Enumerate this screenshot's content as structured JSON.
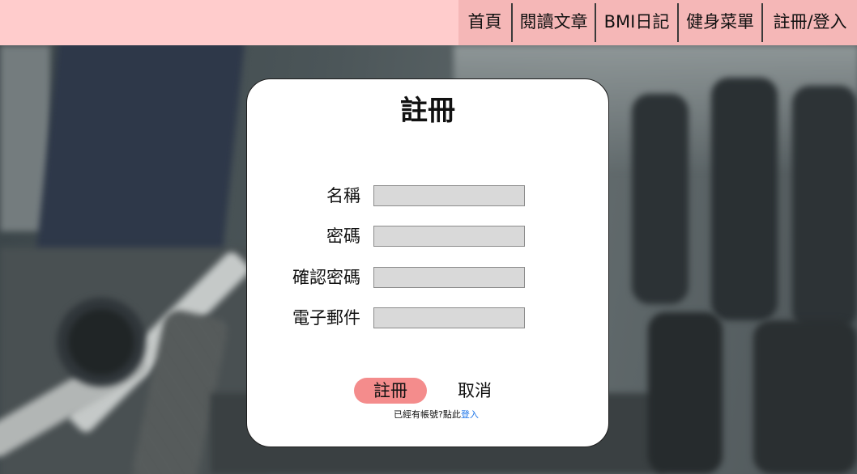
{
  "nav": {
    "items": [
      "首頁",
      "閱讀文章",
      "BMI日記",
      "健身菜單",
      "註冊/登入"
    ]
  },
  "form": {
    "title": "註冊",
    "fields": [
      {
        "label": "名稱",
        "value": ""
      },
      {
        "label": "密碼",
        "value": ""
      },
      {
        "label": "確認密碼",
        "value": ""
      },
      {
        "label": "電子郵件",
        "value": ""
      }
    ],
    "submit_label": "註冊",
    "cancel_label": "取消",
    "login_prompt": "已經有帳號?點此",
    "login_link": "登入"
  },
  "colors": {
    "header_bg": "#ffcccc",
    "nav_bg": "#f5b7b7",
    "submit_bg": "#f48c8c",
    "input_bg": "#d9d9d9",
    "link": "#1a73e8"
  }
}
